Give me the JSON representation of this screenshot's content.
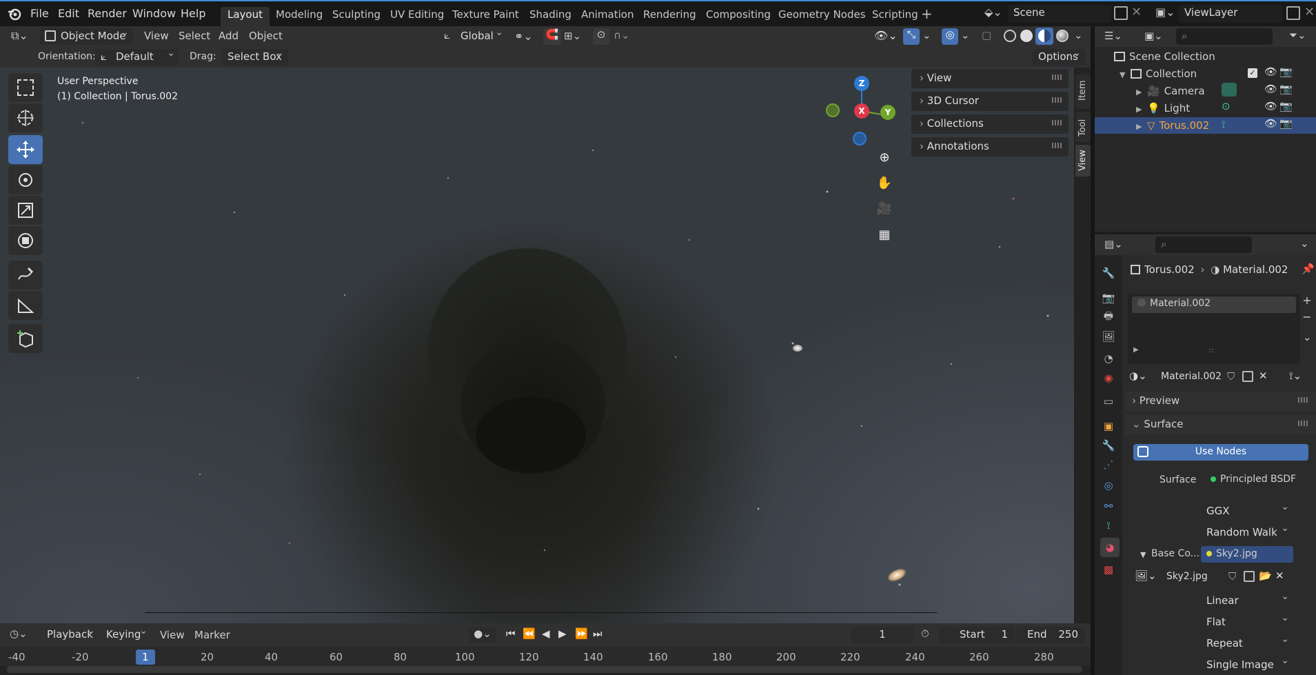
{
  "topbar": {
    "menus": [
      "File",
      "Edit",
      "Render",
      "Window",
      "Help"
    ],
    "workspaces": [
      "Layout",
      "Modeling",
      "Sculpting",
      "UV Editing",
      "Texture Paint",
      "Shading",
      "Animation",
      "Rendering",
      "Compositing",
      "Geometry Nodes",
      "Scripting"
    ],
    "active_workspace": "Layout",
    "add_tab": "+",
    "scene": "Scene",
    "view_layer": "ViewLayer"
  },
  "viewport_header": {
    "mode": "Object Mode",
    "menus": [
      "View",
      "Select",
      "Add",
      "Object"
    ],
    "transform_orientation": "Global"
  },
  "tool_settings": {
    "orientation_label": "Orientation:",
    "orientation_value": "Default",
    "drag_label": "Drag:",
    "drag_value": "Select Box",
    "options": "Options"
  },
  "viewport": {
    "perspective": "User Perspective",
    "object_info": "(1) Collection | Torus.002",
    "gizmo": {
      "z": "Z",
      "x": "X",
      "y": "Y"
    }
  },
  "npanel": {
    "rows": [
      "View",
      "3D Cursor",
      "Collections",
      "Annotations"
    ],
    "tabs": [
      "Item",
      "Tool",
      "View"
    ]
  },
  "outliner": {
    "scene_collection": "Scene Collection",
    "items": [
      {
        "label": "Collection"
      },
      {
        "label": "Camera"
      },
      {
        "label": "Light"
      },
      {
        "label": "Torus.002"
      }
    ]
  },
  "properties": {
    "breadcrumb_object": "Torus.002",
    "breadcrumb_material": "Material.002",
    "slot_material": "Material.002",
    "material_name": "Material.002",
    "preview": "Preview",
    "surface_section": "Surface",
    "use_nodes": "Use Nodes",
    "surface_label": "Surface",
    "surface_value": "Principled BSDF",
    "distribution": "GGX",
    "subsurface": "Random Walk",
    "base_color_label": "Base Co...",
    "base_color_value": "Sky2.jpg",
    "image_name": "Sky2.jpg",
    "interpolation": "Linear",
    "projection": "Flat",
    "extension": "Repeat",
    "source": "Single Image"
  },
  "timeline": {
    "menus": [
      "Playback",
      "Keying",
      "View",
      "Marker"
    ],
    "current_frame": "1",
    "start_label": "Start",
    "start_value": "1",
    "end_label": "End",
    "end_value": "250",
    "ticks": [
      "-40",
      "-20",
      "1",
      "20",
      "40",
      "60",
      "80",
      "100",
      "120",
      "140",
      "160",
      "180",
      "200",
      "220",
      "240",
      "260",
      "280"
    ]
  },
  "colors": {
    "accent": "#4772b3",
    "selected_object": "#f5a442",
    "axis_x": "#e0384b",
    "axis_y": "#70a62a",
    "axis_z": "#2e7bd6"
  }
}
